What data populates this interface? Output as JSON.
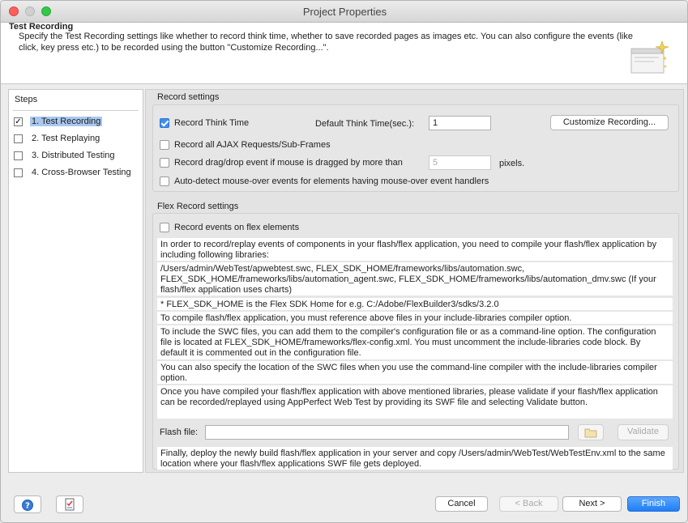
{
  "window": {
    "title": "Project Properties"
  },
  "header": {
    "title": "Test Recording",
    "description": "Specify the Test Recording settings like whether to record think time, whether to save recorded pages as images etc. You can also configure the events (like click, key press etc.) to be recorded using the button \"Customize Recording...\"."
  },
  "steps": {
    "title": "Steps",
    "items": [
      {
        "label": "1. Test Recording",
        "checked": true,
        "selected": true
      },
      {
        "label": "2. Test Replaying",
        "checked": false,
        "selected": false
      },
      {
        "label": "3. Distributed Testing",
        "checked": false,
        "selected": false
      },
      {
        "label": "4. Cross-Browser Testing",
        "checked": false,
        "selected": false
      }
    ]
  },
  "record": {
    "title": "Record settings",
    "think_time_label": "Record Think Time",
    "think_time_checked": true,
    "default_think_label": "Default Think Time(sec.):",
    "default_think_value": "1",
    "customize_button": "Customize Recording...",
    "ajax_label": "Record all AJAX Requests/Sub-Frames",
    "drag_label": "Record drag/drop event if mouse is dragged by more than",
    "drag_value": "5",
    "pixels_label": "pixels.",
    "mouseover_label": "Auto-detect mouse-over events for elements having mouse-over event handlers"
  },
  "flex": {
    "title": "Flex Record settings",
    "flex_events_label": "Record events on flex elements",
    "paragraphs": [
      "In order to record/replay events of components in your flash/flex application, you need to compile your flash/flex application by including following libraries:",
      "/Users/admin/WebTest/apwebtest.swc, FLEX_SDK_HOME/frameworks/libs/automation.swc, FLEX_SDK_HOME/frameworks/libs/automation_agent.swc, FLEX_SDK_HOME/frameworks/libs/automation_dmv.swc (If your flash/flex application uses charts)",
      "* FLEX_SDK_HOME is the Flex SDK Home for e.g. C:/Adobe/FlexBuilder3/sdks/3.2.0",
      "To compile flash/flex application, you must reference above files in your include-libraries compiler option.",
      "To include the SWC files, you can add them to the compiler's configuration file or as a command-line option. The configuration file is located at FLEX_SDK_HOME/frameworks/flex-config.xml. You must uncomment the include-libraries code block. By default it is commented out in the configuration file.",
      "You can also specify the location of the SWC files when you use the command-line compiler with the include-libraries compiler option.",
      "Once you have compiled your flash/flex application with above mentioned libraries, please validate if your flash/flex application can be recorded/replayed using AppPerfect Web Test by providing its SWF file and selecting Validate button."
    ],
    "flash_file_label": "Flash file:",
    "flash_file_value": "",
    "validate_button": "Validate",
    "final_paragraph": "Finally, deploy the newly build flash/flex application in your server and copy /Users/admin/WebTest/WebTestEnv.xml to the same location where your flash/flex applications SWF file gets deployed."
  },
  "footer": {
    "cancel": "Cancel",
    "back": "< Back",
    "next": "Next >",
    "finish": "Finish"
  },
  "colors": {
    "accent": "#1e7ef7",
    "selection": "#a9c8f0"
  }
}
